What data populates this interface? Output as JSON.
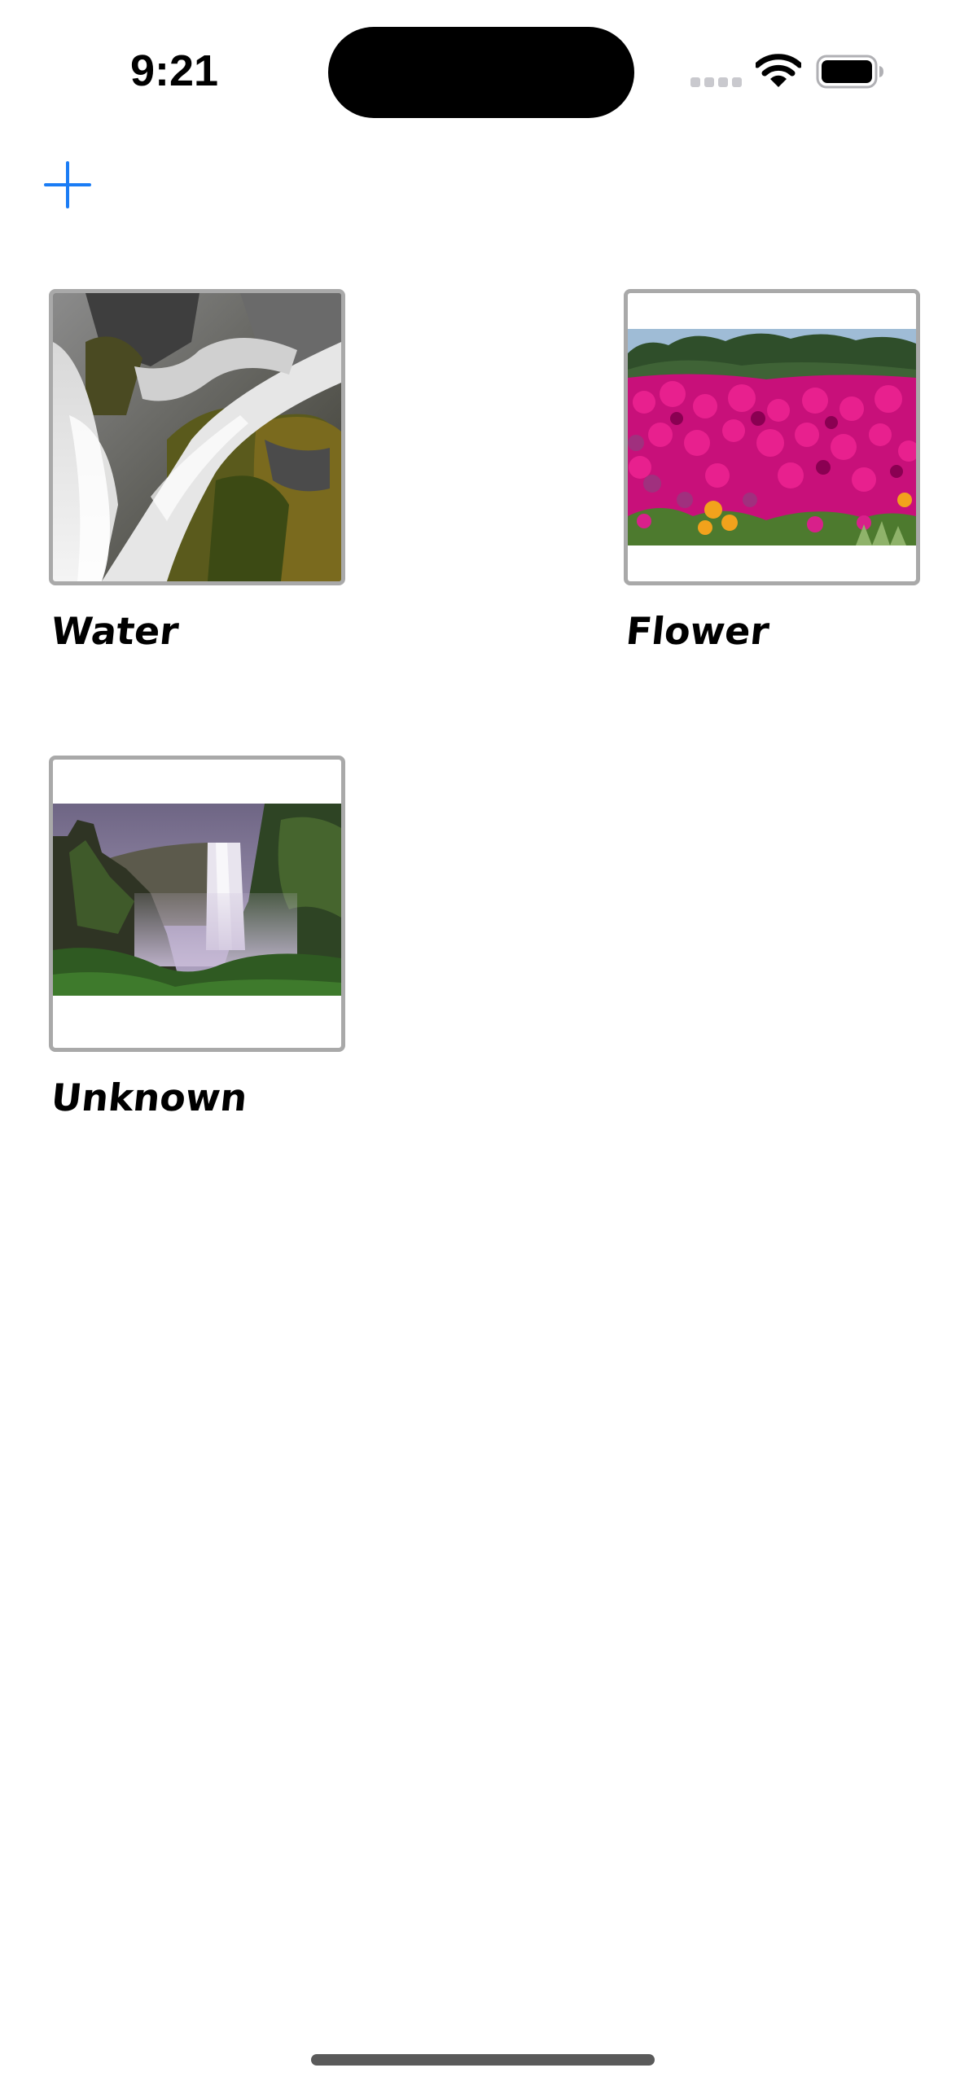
{
  "status_bar": {
    "time": "9:21",
    "icons": [
      "cellular-signal-icon",
      "wifi-icon",
      "battery-icon"
    ]
  },
  "toolbar": {
    "add_icon": "plus-icon",
    "accent_color": "#1a7cf5"
  },
  "items": [
    {
      "label": "Water",
      "photo": "waterfall-closeup"
    },
    {
      "label": "Flower",
      "photo": "magenta-flower-field"
    },
    {
      "label": "Unknown",
      "photo": "waterfall-canyon"
    }
  ]
}
